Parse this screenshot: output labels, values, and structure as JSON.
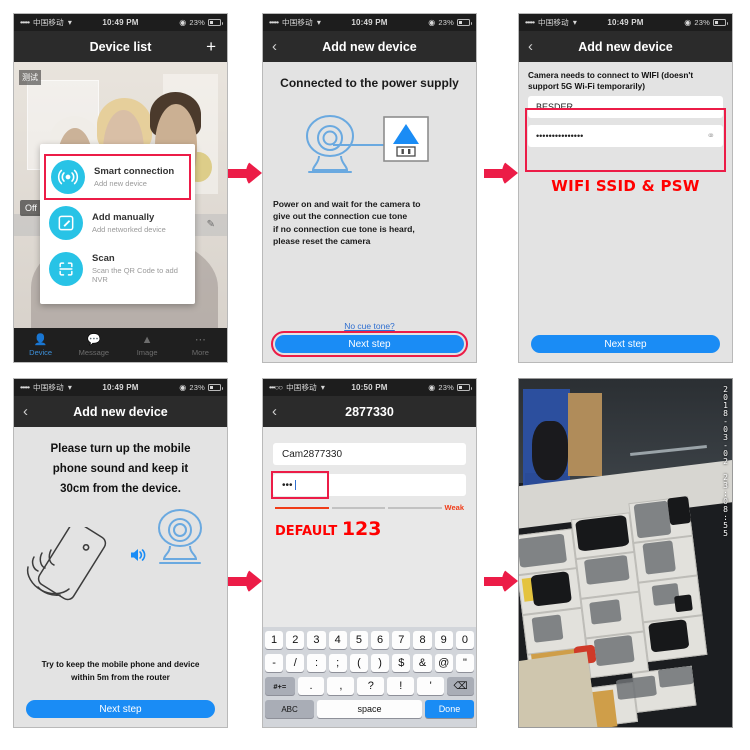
{
  "status_bars": {
    "carrier": "中国移动",
    "time_1049": "10:49 PM",
    "time_1050": "10:50 PM",
    "battery": "23%",
    "dots": "•••••",
    "dots_light": "•••○○",
    "wifi_icon": "wifi-icon"
  },
  "panel1": {
    "nav_title": "Device list",
    "plus_label": "+",
    "tag_test": "测试",
    "tag_off": "Off",
    "options": [
      {
        "title": "Smart connection",
        "subtitle": "Add new device",
        "icon": "smart-connection-icon",
        "highlighted": true
      },
      {
        "title": "Add manually",
        "subtitle": "Add networked device",
        "icon": "edit-square-icon",
        "highlighted": false
      },
      {
        "title": "Scan",
        "subtitle": "Scan the QR Code to add NVR",
        "icon": "scan-frame-icon",
        "highlighted": false
      }
    ],
    "tabs": [
      {
        "label": "Device",
        "icon": "person-icon",
        "active": true
      },
      {
        "label": "Message",
        "icon": "chat-bubble-icon",
        "active": false
      },
      {
        "label": "Image",
        "icon": "photo-mountain-icon",
        "active": false
      },
      {
        "label": "More",
        "icon": "ellipsis-icon",
        "active": false
      }
    ]
  },
  "panel2": {
    "nav_title": "Add new device",
    "back_icon": "chevron-left-icon",
    "headline": "Connected to the power supply",
    "diagram": {
      "camera_icon": "ip-camera-icon",
      "plug_icon": "power-plug-icon"
    },
    "paragraph_lines": [
      "Power on and wait for the camera to",
      "give out the connection cue tone",
      " if no connection cue tone is heard,",
      "please reset the camera"
    ],
    "link": "No cue tone?",
    "next_button": "Next step"
  },
  "panel3": {
    "nav_title": "Add new device",
    "note": "Camera needs to connect to WIFI (doesn't support 5G Wi-Fi temporarily)",
    "ssid_value": "BESDER",
    "password_value": "•••••••••••••••",
    "eye_icon": "eye-off-icon",
    "red_caption": "WIFI SSID & PSW",
    "next_button": "Next step"
  },
  "panel4": {
    "nav_title": "Add new device",
    "headline_lines": [
      "Please turn up the mobile",
      "phone sound and keep it",
      "30cm from the device."
    ],
    "illustration": {
      "hand_phone_icon": "hand-holding-phone-icon",
      "sound_icon": "sound-waves-icon",
      "camera_icon": "ip-camera-icon"
    },
    "bottom_note_lines": [
      "Try to keep the mobile phone and device",
      "within 5m from the router"
    ],
    "next_button": "Next step"
  },
  "panel5": {
    "nav_title": "2877330",
    "device_name_value": "Cam2877330",
    "password_value": "•••",
    "strength_label": "Weak",
    "strength_segments_on": 1,
    "strength_segments_total": 3,
    "red_caption_prefix": "DEFAULT ",
    "red_caption_number": "123",
    "keyboard": {
      "row1": [
        "1",
        "2",
        "3",
        "4",
        "5",
        "6",
        "7",
        "8",
        "9",
        "0"
      ],
      "row2": [
        "-",
        "/",
        ":",
        ";",
        "(",
        ")",
        "$",
        "&",
        "@",
        "\""
      ],
      "row3": [
        "#+=",
        ".",
        ",",
        "?",
        "!",
        "'",
        "⌫"
      ],
      "row4": [
        "ABC",
        "space",
        "Done"
      ]
    }
  },
  "panel6": {
    "view_type": "live-camera-feed",
    "timestamp": "2018-03-02 23:08:55"
  },
  "arrows": {
    "count": 4,
    "color": "#ec1c47",
    "icon": "arrow-right-icon"
  }
}
